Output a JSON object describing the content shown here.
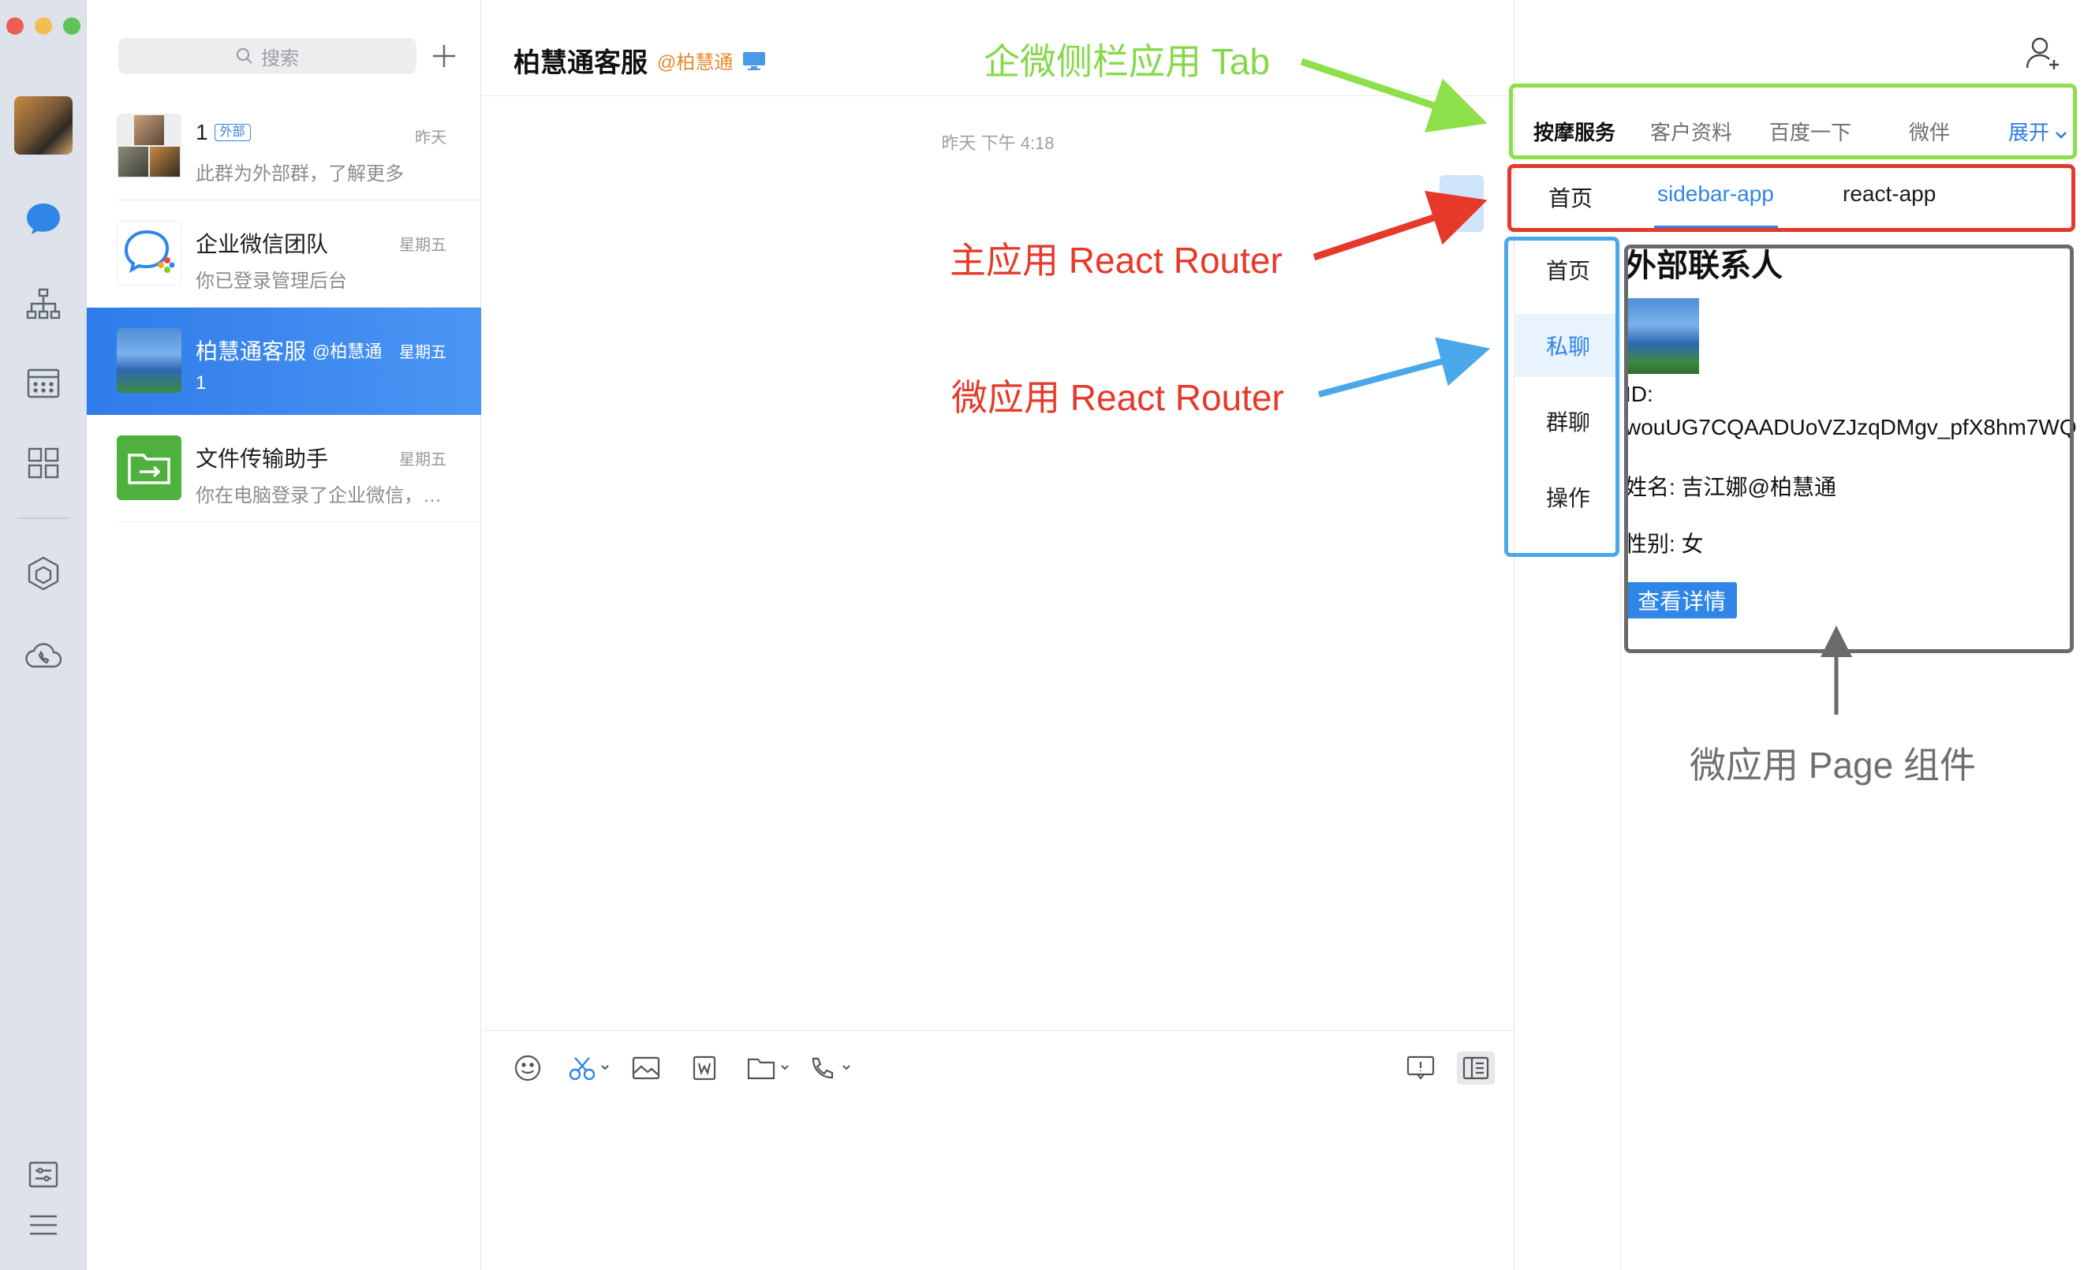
{
  "search": {
    "placeholder": "搜索"
  },
  "conversations": [
    {
      "name": "1",
      "tag": "外部",
      "time": "昨天",
      "preview": "此群为外部群，了解更多"
    },
    {
      "name": "企业微信团队",
      "time": "星期五",
      "preview": "你已登录管理后台"
    },
    {
      "name": "柏慧通客服",
      "corp": "@柏慧通",
      "time": "星期五",
      "preview": "1"
    },
    {
      "name": "文件传输助手",
      "time": "星期五",
      "preview": "你在电脑登录了企业微信，…"
    }
  ],
  "chat": {
    "title": "柏慧通客服",
    "corp": "@柏慧通",
    "timestamp": "昨天 下午 4:18"
  },
  "sidebar": {
    "tabs": [
      "按摩服务",
      "客户资料",
      "百度一下",
      "微伴"
    ],
    "expand_label": "展开",
    "main_router": [
      "首页",
      "sidebar-app",
      "react-app"
    ],
    "micro_router": [
      "首页",
      "私聊",
      "群聊",
      "操作"
    ],
    "page": {
      "heading": "外部联系人",
      "id_label": "ID:",
      "id_value": "wouUG7CQAADUoVZJzqDMgv_pfX8hm7WQ",
      "name_line": "姓名: 吉江娜@柏慧通",
      "gender_line": "性别: 女",
      "detail_button": "查看详情"
    }
  },
  "annotations": {
    "sidebar_tab": "企微侧栏应用 Tab",
    "main_router": "主应用 React Router",
    "micro_router": "微应用 React Router",
    "page_component": "微应用 Page 组件"
  },
  "colors": {
    "accent": "#2f86e6",
    "annotation_green": "#8ee04a",
    "annotation_red": "#e6392a",
    "annotation_blue": "#4aa8e8",
    "annotation_gray": "#6a6a6a"
  }
}
